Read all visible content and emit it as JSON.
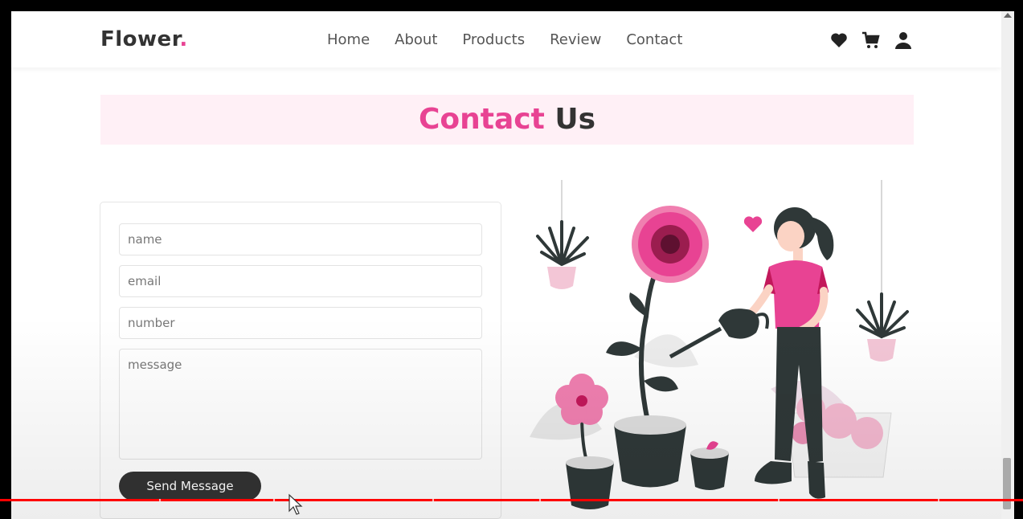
{
  "brand": {
    "name": "Flower",
    "dot": "."
  },
  "nav": [
    "Home",
    "About",
    "Products",
    "Review",
    "Contact"
  ],
  "header_icons": [
    "heart-icon",
    "cart-icon",
    "user-icon"
  ],
  "heading": {
    "accent": "Contact",
    "rest": " Us"
  },
  "form": {
    "name_placeholder": "name",
    "email_placeholder": "email",
    "number_placeholder": "number",
    "message_placeholder": "message",
    "submit_label": "Send Message"
  },
  "colors": {
    "accent": "#e84393",
    "dark": "#333333",
    "heading_bg": "#fff0f6"
  }
}
